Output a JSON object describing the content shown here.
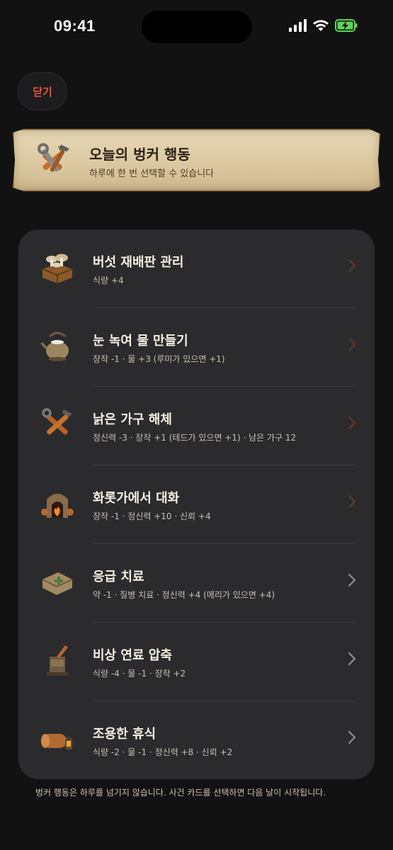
{
  "status_bar": {
    "time": "09:41"
  },
  "close_label": "닫기",
  "banner": {
    "title": "오늘의 벙커 행동",
    "subtitle": "하루에 한 번 선택할 수 있습니다"
  },
  "actions": [
    {
      "title": "버섯 재배판 관리",
      "desc": "식량 +4",
      "icon": "mushroom-crate-icon",
      "chevron_color": "#5a3a2c"
    },
    {
      "title": "눈 녹여 물 만들기",
      "desc": "장작 -1 · 물 +3 (루미가 있으면 +1)",
      "icon": "kettle-icon",
      "chevron_color": "#5a3a2c"
    },
    {
      "title": "낡은 가구 해체",
      "desc": "정신력 -3 · 장작 +1 (테드가 있으면 +1) · 남은 가구 12",
      "icon": "tools-icon",
      "chevron_color": "#6a3424"
    },
    {
      "title": "화롯가에서 대화",
      "desc": "장작 -1 · 정신력 +10 · 신뢰 +4",
      "icon": "fireplace-icon",
      "chevron_color": "#5a3a2c"
    },
    {
      "title": "응급 치료",
      "desc": "약 -1 · 질병 치료 · 정신력 +4 (메리가 있으면 +4)",
      "icon": "medkit-icon",
      "chevron_color": "#8e8e93"
    },
    {
      "title": "비상 연료 압축",
      "desc": "식량 -4 · 물 -1 · 장작 +2",
      "icon": "fuel-press-icon",
      "chevron_color": "#8e8e93"
    },
    {
      "title": "조용한 휴식",
      "desc": "식량 -2 · 물 -1 · 정신력 +8 · 신뢰 +2",
      "icon": "bedroll-lantern-icon",
      "chevron_color": "#8e8e93"
    }
  ],
  "footer_note": "벙커 행동은 하루를 넘기지 않습니다. 사건 카드를 선택하면 다음 날이 시작됩니다.",
  "colors": {
    "accent": "#e8543a",
    "background": "#121212",
    "card": "#2b2b2d"
  }
}
